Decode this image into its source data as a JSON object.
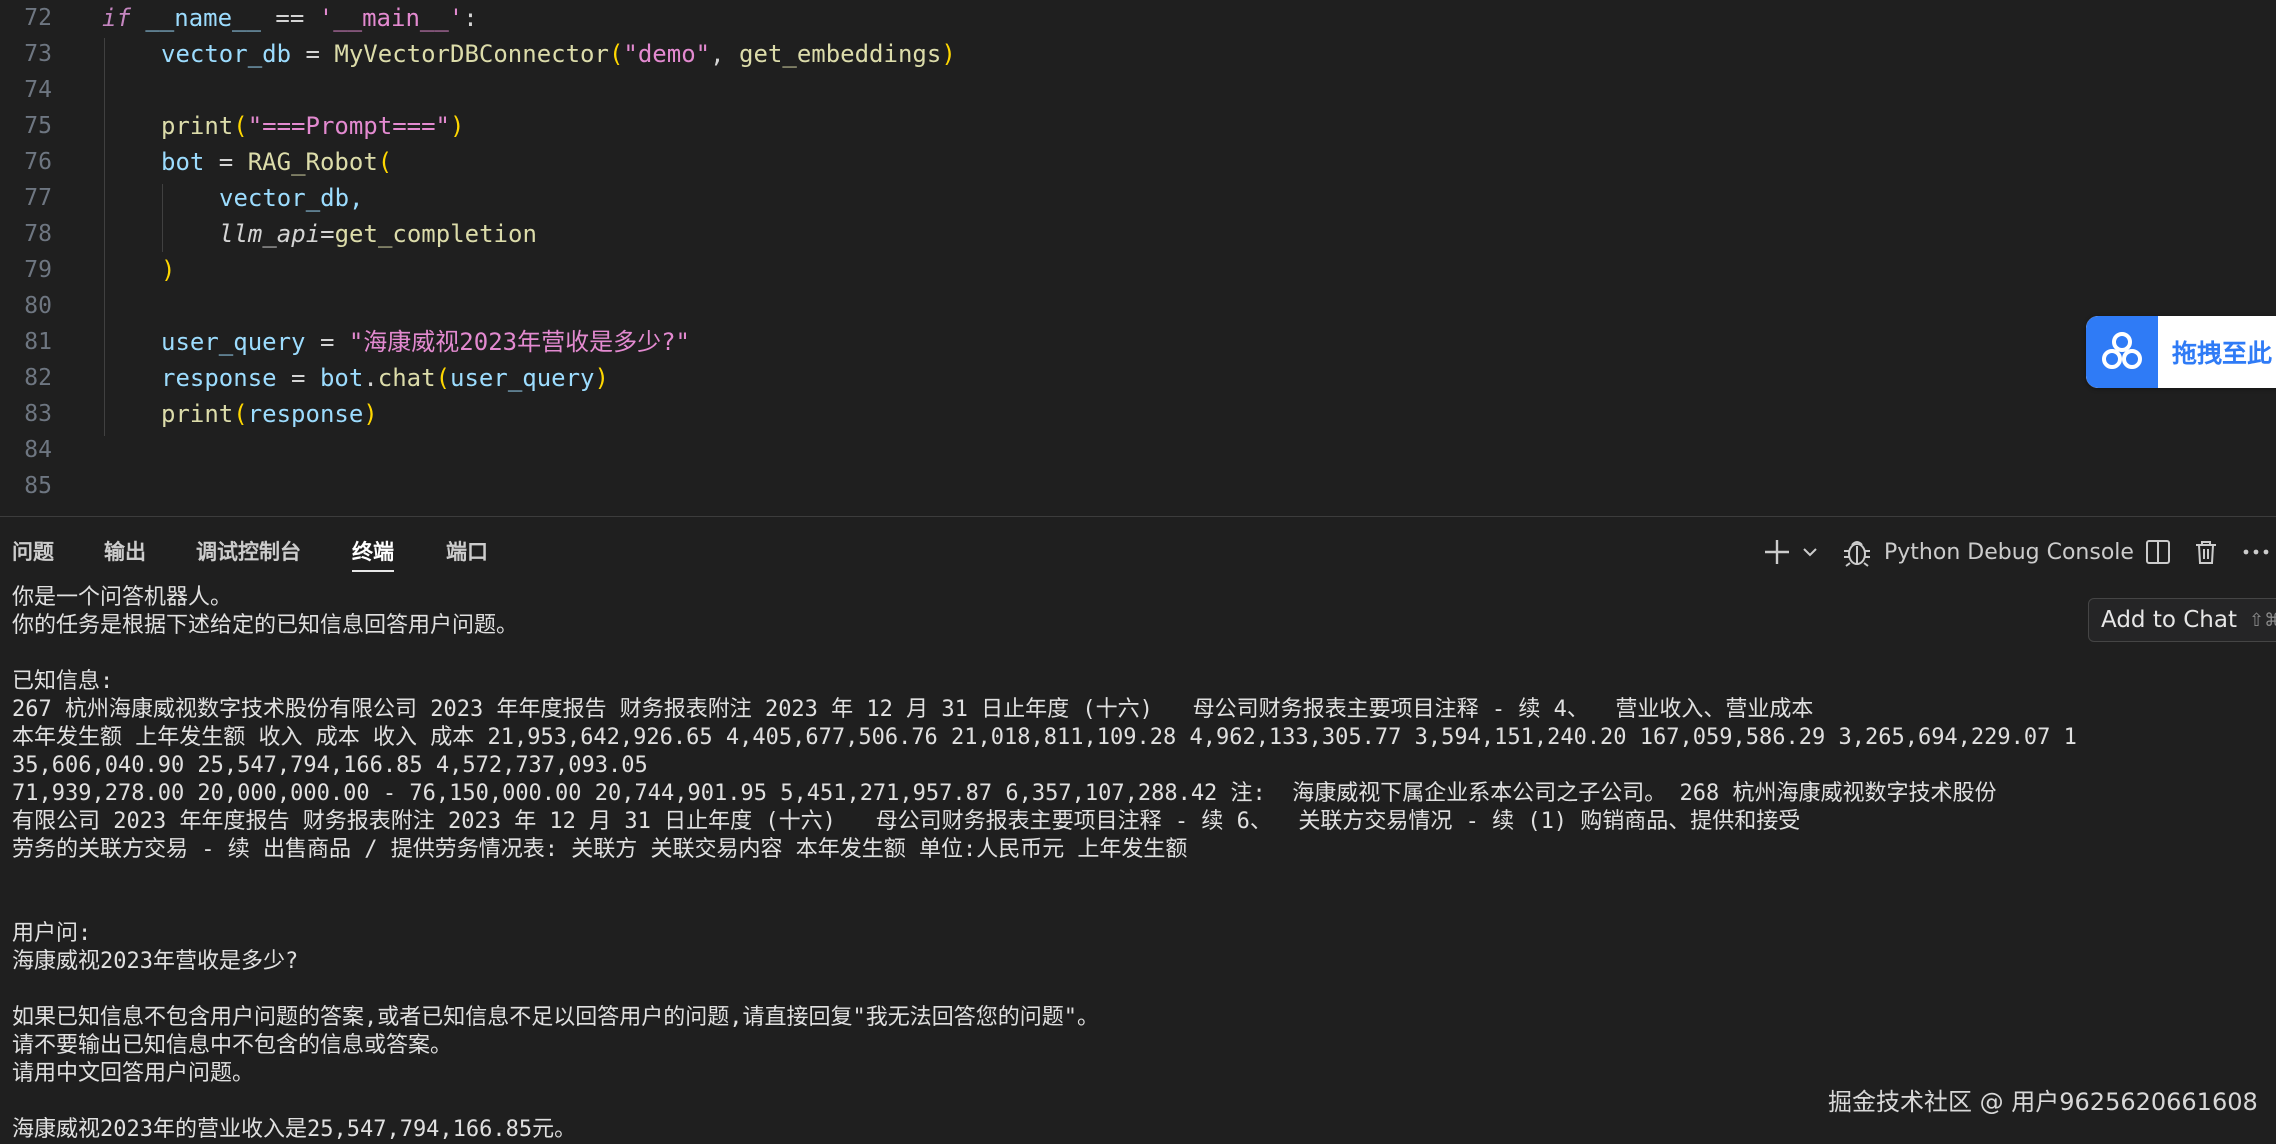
{
  "editor": {
    "lines": [
      {
        "num": "72"
      },
      {
        "num": "73"
      },
      {
        "num": "74"
      },
      {
        "num": "75"
      },
      {
        "num": "76"
      },
      {
        "num": "77"
      },
      {
        "num": "78"
      },
      {
        "num": "79"
      },
      {
        "num": "80"
      },
      {
        "num": "81"
      },
      {
        "num": "82"
      },
      {
        "num": "83"
      },
      {
        "num": "84"
      },
      {
        "num": "85"
      }
    ],
    "tokens": {
      "if_kw": "if",
      "name_dunder": "__name__",
      "eq": " == ",
      "main_str": "'__main__'",
      "colon": ":",
      "vector_db": "vector_db",
      "assign": " = ",
      "connector_cls": "MyVectorDBConnector",
      "demo_str": "\"demo\"",
      "comma_space": ", ",
      "get_embeddings": "get_embeddings",
      "print": "print",
      "prompt_str": "\"===Prompt===\"",
      "bot": "bot",
      "rag_robot": "RAG_Robot",
      "vector_db_arg": "vector_db,",
      "llm_api": "llm_api",
      "eq_noSpace": "=",
      "get_completion": "get_completion",
      "user_query": "user_query",
      "query_str": "\"海康威视2023年营收是多少?\"",
      "response": "response",
      "dot": ".",
      "chat": "chat",
      "lparen": "(",
      "rparen": ")"
    }
  },
  "drag_widget": {
    "label": "拖拽至此"
  },
  "panel": {
    "tabs": [
      {
        "label": "问题"
      },
      {
        "label": "输出"
      },
      {
        "label": "调试控制台"
      },
      {
        "label": "终端"
      },
      {
        "label": "端口"
      }
    ],
    "active_tab": "终端",
    "terminal_name": "Python Debug Console"
  },
  "terminal": {
    "lines": [
      "你是一个问答机器人。",
      "你的任务是根据下述给定的已知信息回答用户问题。",
      "",
      "已知信息:",
      "267 杭州海康威视数字技术股份有限公司 2023 年年度报告 财务报表附注 2023 年 12 月 31 日止年度 (十六)   母公司财务报表主要项目注释 - 续 4、  营业收入、营业成本",
      "本年发生额 上年发生额 收入 成本 收入 成本 21,953,642,926.65 4,405,677,506.76 21,018,811,109.28 4,962,133,305.77 3,594,151,240.20 167,059,586.29 3,265,694,229.07 1",
      "35,606,040.90 25,547,794,166.85 4,572,737,093.05",
      "71,939,278.00 20,000,000.00 - 76,150,000.00 20,744,901.95 5,451,271,957.87 6,357,107,288.42 注:  海康威视下属企业系本公司之子公司。 268 杭州海康威视数字技术股份",
      "有限公司 2023 年年度报告 财务报表附注 2023 年 12 月 31 日止年度 (十六)   母公司财务报表主要项目注释 - 续 6、  关联方交易情况 - 续 (1) 购销商品、提供和接受",
      "劳务的关联方交易 - 续 出售商品 / 提供劳务情况表: 关联方 关联交易内容 本年发生额 单位:人民币元 上年发生额",
      "",
      "",
      "用户问:",
      "海康威视2023年营收是多少?",
      "",
      "如果已知信息不包含用户问题的答案,或者已知信息不足以回答用户的问题,请直接回复\"我无法回答您的问题\"。",
      "请不要输出已知信息中不包含的信息或答案。",
      "请用中文回答用户问题。",
      "",
      "海康威视2023年的营业收入是25,547,794,166.85元。"
    ]
  },
  "add_to_chat": {
    "label": "Add to Chat",
    "shortcut": "⇧⌘"
  },
  "watermark": "掘金技术社区 @ 用户9625620661608",
  "colors": {
    "background": "#1f1f1f",
    "keyword": "#c586c0",
    "variable": "#9cdcfe",
    "function": "#dcdcaa",
    "string": "#e38ad0",
    "bracket1": "#ffd700",
    "bracket2": "#da70d6",
    "widget_blue": "#2f7bf6"
  }
}
